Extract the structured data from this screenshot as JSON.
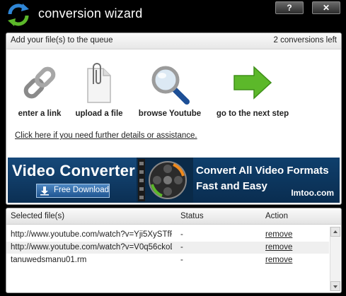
{
  "window": {
    "title": "conversion wizard",
    "help_label": "?",
    "close_label": "✕"
  },
  "queue_panel": {
    "instruction": "Add your file(s) to the queue",
    "conversions_left": "2 conversions left",
    "actions": [
      {
        "label": "enter a link",
        "icon": "chain-link-icon"
      },
      {
        "label": "upload a file",
        "icon": "paperclip-document-icon"
      },
      {
        "label": "browse Youtube",
        "icon": "magnifier-icon"
      },
      {
        "label": "go to the next step",
        "icon": "green-arrow-right-icon"
      }
    ],
    "help_link": "Click here if you need further details or assistance."
  },
  "banner": {
    "title": "Video Converter",
    "download_label": "Free Download",
    "line1": "Convert All Video Formats",
    "line2": "Fast and Easy",
    "site": "Imtoo.com"
  },
  "file_list": {
    "columns": [
      "Selected file(s)",
      "Status",
      "Action"
    ],
    "rows": [
      {
        "file": "http://www.youtube.com/watch?v=Yji5XySTfF",
        "status": "-",
        "action": "remove"
      },
      {
        "file": "http://www.youtube.com/watch?v=V0q56ckoD",
        "status": "-",
        "action": "remove"
      },
      {
        "file": "tanuwedsmanu01.rm",
        "status": "-",
        "action": "remove"
      }
    ]
  },
  "colors": {
    "arrow_green": "#5cb82a",
    "logo_blue": "#2f86d6",
    "banner_blue": "#0d3a64"
  }
}
